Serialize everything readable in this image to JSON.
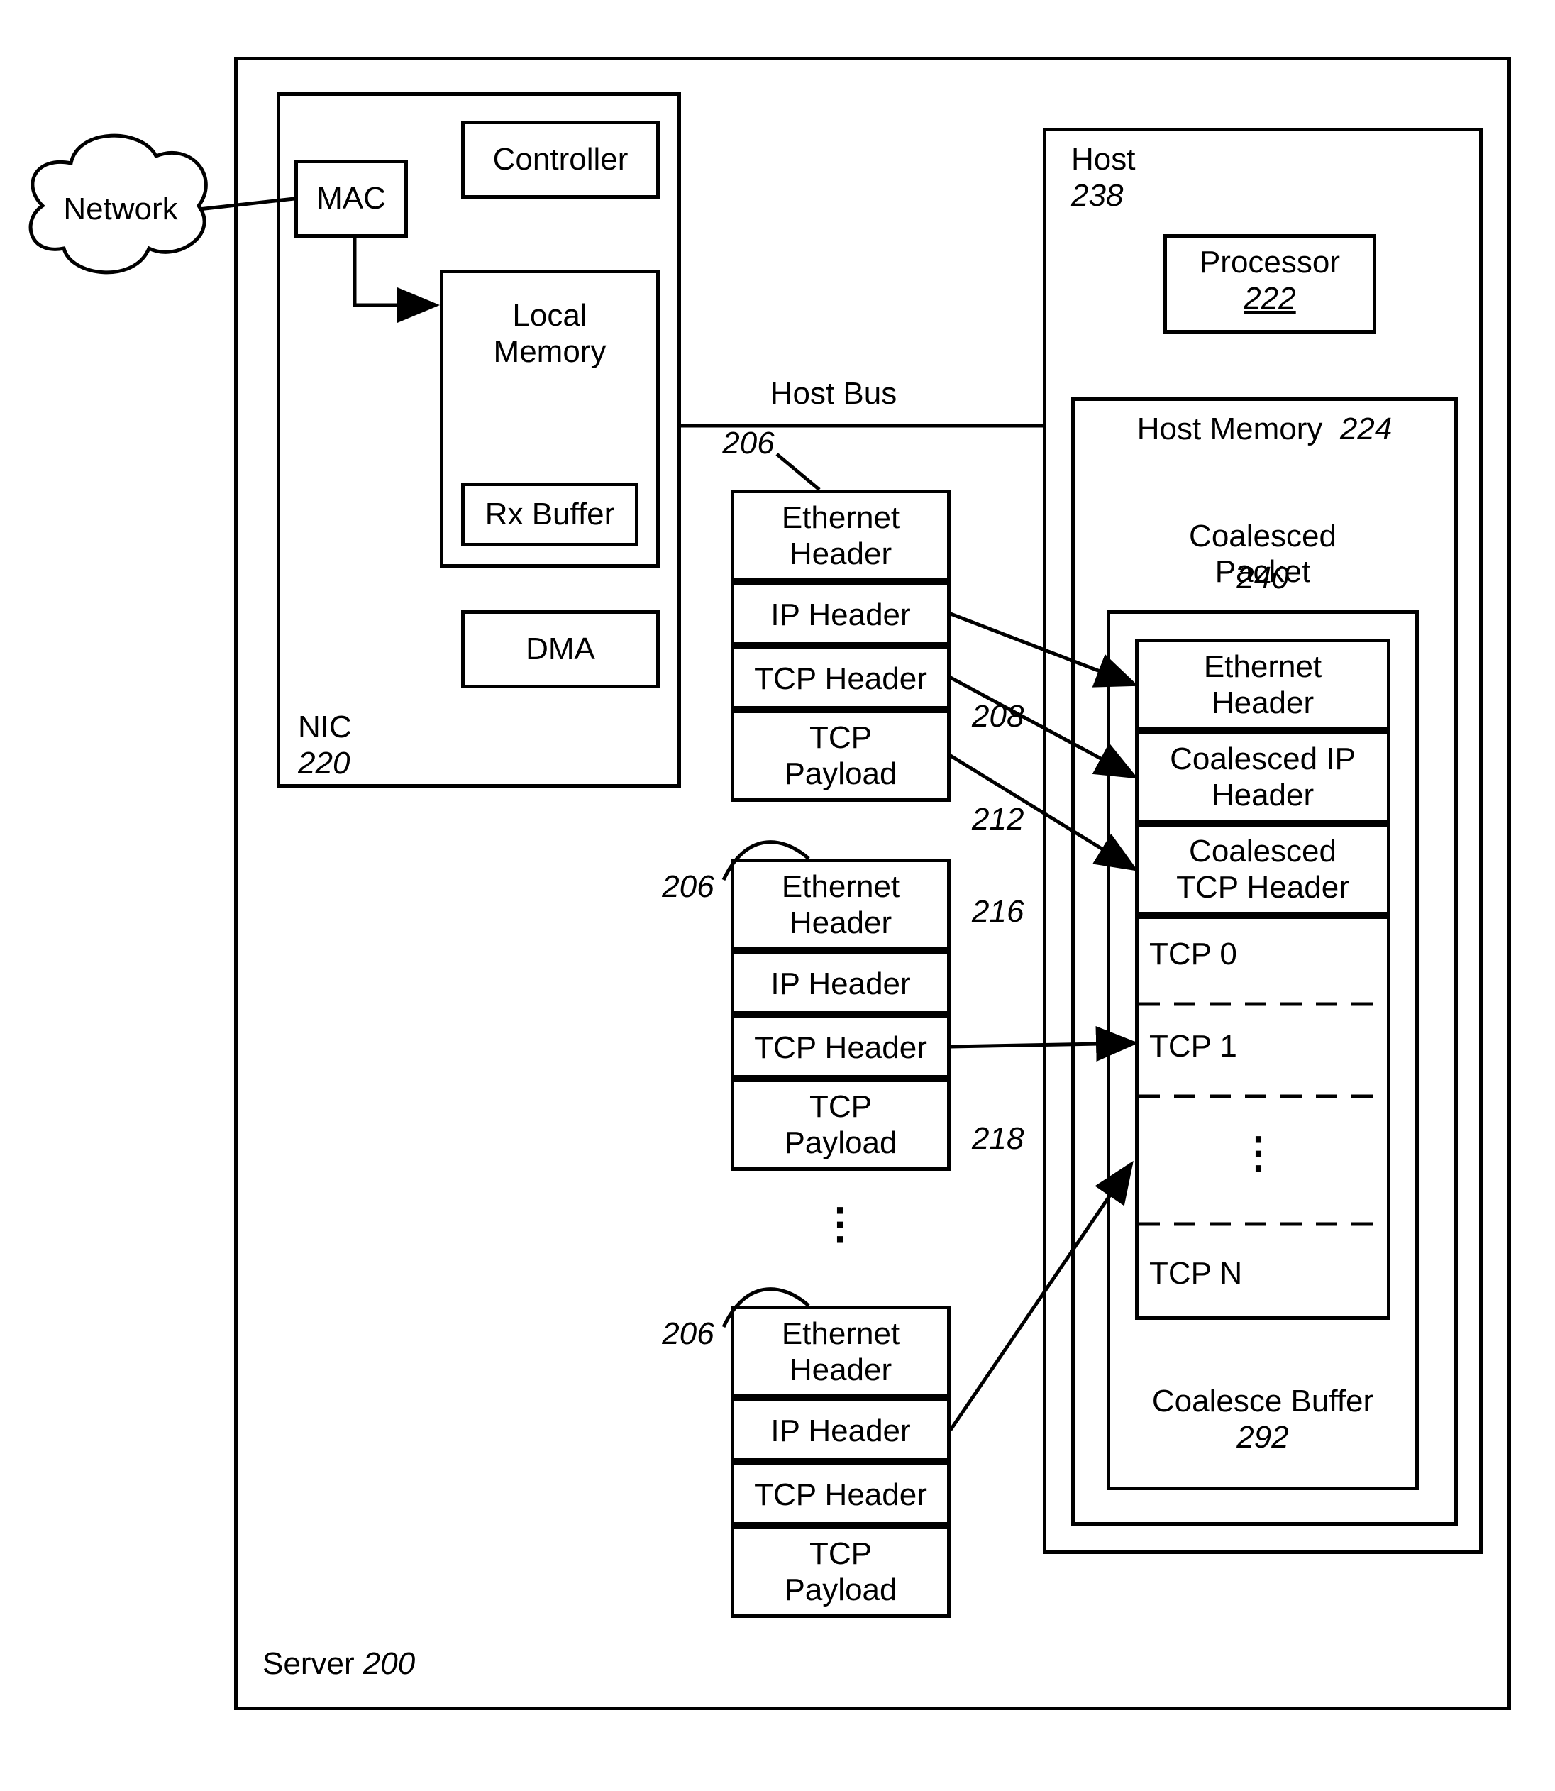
{
  "network_label": "Network",
  "server": {
    "title": "Server",
    "num": "200"
  },
  "nic": {
    "title": "NIC",
    "num": "220",
    "mac": "MAC",
    "controller": "Controller",
    "local_memory": "Local\nMemory",
    "rx_buffer": "Rx Buffer",
    "dma": "DMA"
  },
  "host_bus": "Host Bus",
  "pkt_label_206_a": "206",
  "pkt_label_206_b": "206",
  "pkt_label_206_c": "206",
  "packet": {
    "eth": "Ethernet\nHeader",
    "ip": "IP Header",
    "tcp": "TCP Header",
    "payload": "TCP\nPayload"
  },
  "arrow_labels": {
    "r208": "208",
    "r212": "212",
    "r216": "216",
    "r218": "218"
  },
  "host": {
    "title": "Host",
    "num": "238",
    "processor": "Processor",
    "processor_num": "222",
    "memory": "Host Memory",
    "memory_num": "224",
    "coalesced_packet": "Coalesced\nPacket",
    "coalesced_packet_num": "240",
    "buffer": {
      "eth": "Ethernet\nHeader",
      "ip": "Coalesced IP\nHeader",
      "tcp": "Coalesced\nTCP Header",
      "tcp0": "TCP 0",
      "tcp1": "TCP 1",
      "tcpn": "TCP N"
    },
    "coalesce_buffer": "Coalesce Buffer",
    "coalesce_buffer_num": "292"
  },
  "vdots": "⋮"
}
